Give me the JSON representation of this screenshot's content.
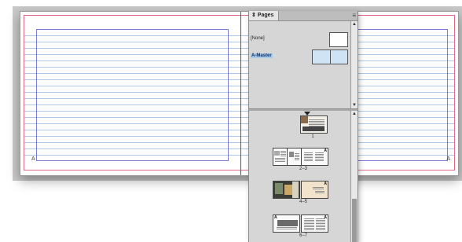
{
  "pages_panel": {
    "tab_label": "⇕ Pages",
    "menu_glyph": "≡",
    "masters": [
      {
        "label": "[None]",
        "selected": false
      },
      {
        "label": "A-Master",
        "selected": true
      }
    ],
    "spreads": [
      {
        "label": "1",
        "pages": 1,
        "master_marker": ""
      },
      {
        "label": "2–3",
        "pages": 2,
        "master_marker": "A"
      },
      {
        "label": "4–5",
        "pages": 2,
        "master_marker": "A"
      },
      {
        "label": "6–7",
        "pages": 2,
        "master_marker": "A"
      }
    ]
  },
  "document": {
    "left_page_marker": "A",
    "right_page_marker": "A"
  },
  "colors": {
    "bleed": "#e06b8a",
    "margin": "#7b7bd8",
    "baseline_grid": "#a9c9e8",
    "selection": "#a8c8e8",
    "panel_bg": "#d6d6d6"
  }
}
